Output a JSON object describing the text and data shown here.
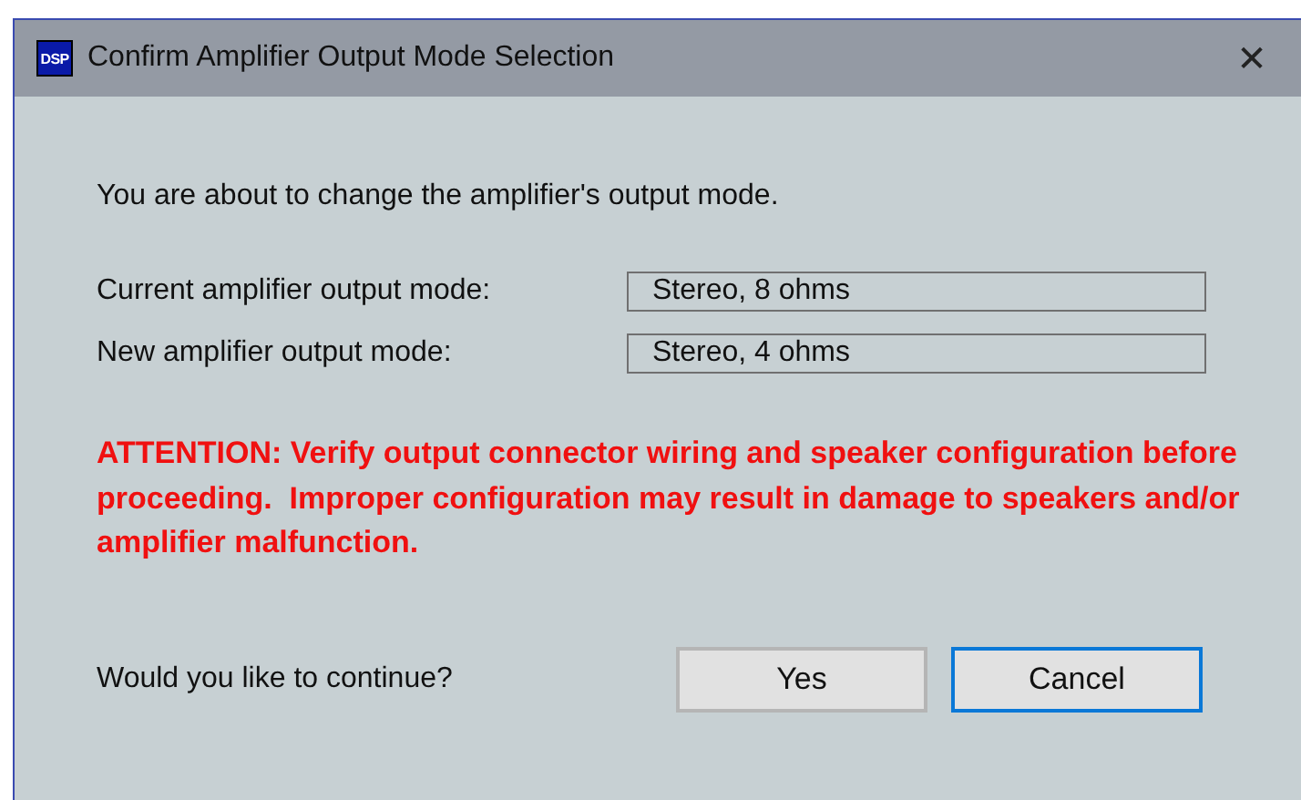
{
  "window": {
    "title": "Confirm Amplifier Output Mode Selection",
    "icon_text": "DSP",
    "close": "✕"
  },
  "message": "You are about to change the amplifier's output mode.",
  "fields": [
    {
      "label": "Current amplifier output mode:",
      "value": "Stereo, 8 ohms"
    },
    {
      "label": "New amplifier output mode:",
      "value": "Stereo, 4 ohms"
    }
  ],
  "warning": "ATTENTION: Verify output connector wiring and speaker configuration before proceeding.  Improper configuration may result in damage to speakers and/or amplifier malfunction.",
  "question": "Would you like to continue?",
  "buttons": [
    {
      "label": "Yes",
      "focused": false
    },
    {
      "label": "Cancel",
      "focused": true
    }
  ]
}
